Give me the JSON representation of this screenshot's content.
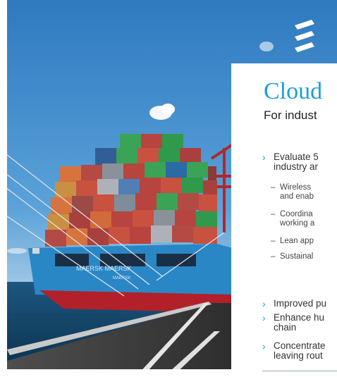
{
  "slide": {
    "title": "Cloud",
    "subtitle": "For indust",
    "bullets": [
      {
        "level": 1,
        "lines": [
          "Evaluate 5",
          "industry ar"
        ]
      },
      {
        "level": 2,
        "lines": [
          "Wireless",
          "and enab"
        ]
      },
      {
        "level": 2,
        "lines": [
          "Coordina",
          "working a"
        ]
      },
      {
        "level": 2,
        "lines": [
          "Lean app"
        ]
      },
      {
        "level": 2,
        "lines": [
          "Sustainal"
        ]
      },
      {
        "level": 1,
        "lines": [
          "Improved pu"
        ]
      },
      {
        "level": 1,
        "lines": [
          "Enhance hu",
          "chain"
        ]
      },
      {
        "level": 1,
        "lines": [
          "Concentrate",
          "leaving rout"
        ]
      }
    ]
  },
  "photo": {
    "ship_name": "MAERSK MAERSK",
    "ship_port": "MAERSK"
  },
  "colors": {
    "accent": "#1a9fd7",
    "hull": "#2a87c6",
    "hull_bottom": "#b2202a",
    "sky": "#3d86c9",
    "sea": "#0f3f63"
  },
  "icons": {
    "logo": "ericsson-logo",
    "bullet": "chevron-right-icon",
    "subbullet": "dash"
  }
}
